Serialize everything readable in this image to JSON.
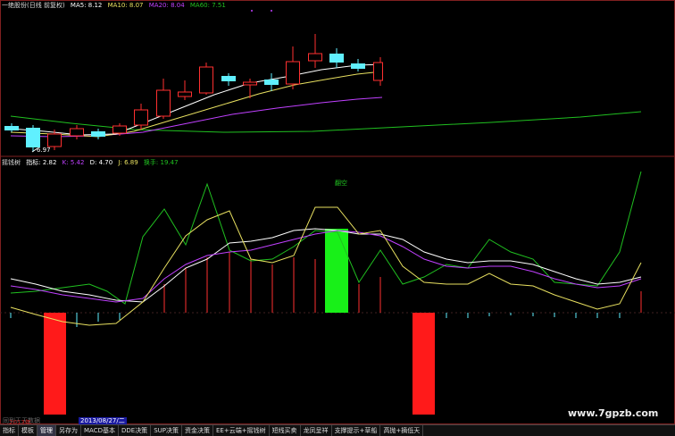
{
  "main_header": {
    "title": "一绝股份(日线 前复权)",
    "ma5": "MA5: 8.12",
    "ma10": "MA10: 8.07",
    "ma20": "MA20: 8.04",
    "ma60": "MA60: 7.51",
    "low_label": "6.97"
  },
  "indicator_header": {
    "name": "摇钱树",
    "zhibiao": "指标: 2.82",
    "k": "K: 5.42",
    "d": "D: 4.70",
    "j": "J: 6.89",
    "huanshou": "换手: 19.47",
    "signal": "翻空"
  },
  "colors": {
    "ma5": "#ffffff",
    "ma10": "#e8e060",
    "ma20": "#c040ff",
    "ma60": "#20c020",
    "up": "#ff3030",
    "down": "#60f0ff",
    "grid": "#802020"
  },
  "status": {
    "left_text": "同到天天数据",
    "year": "2013年",
    "date": "2013/08/27/二"
  },
  "tabs": [
    "指标",
    "模板",
    "管理",
    "另存为",
    "MACD基本",
    "DDE决策",
    "SUP决策",
    "资金决策",
    "EE+云端+摇钱树",
    "短线买卖",
    "龙凤呈祥",
    "支撑提示+草船",
    "高抛+摘低天"
  ],
  "watermark": "www.7gpzb.com"
}
